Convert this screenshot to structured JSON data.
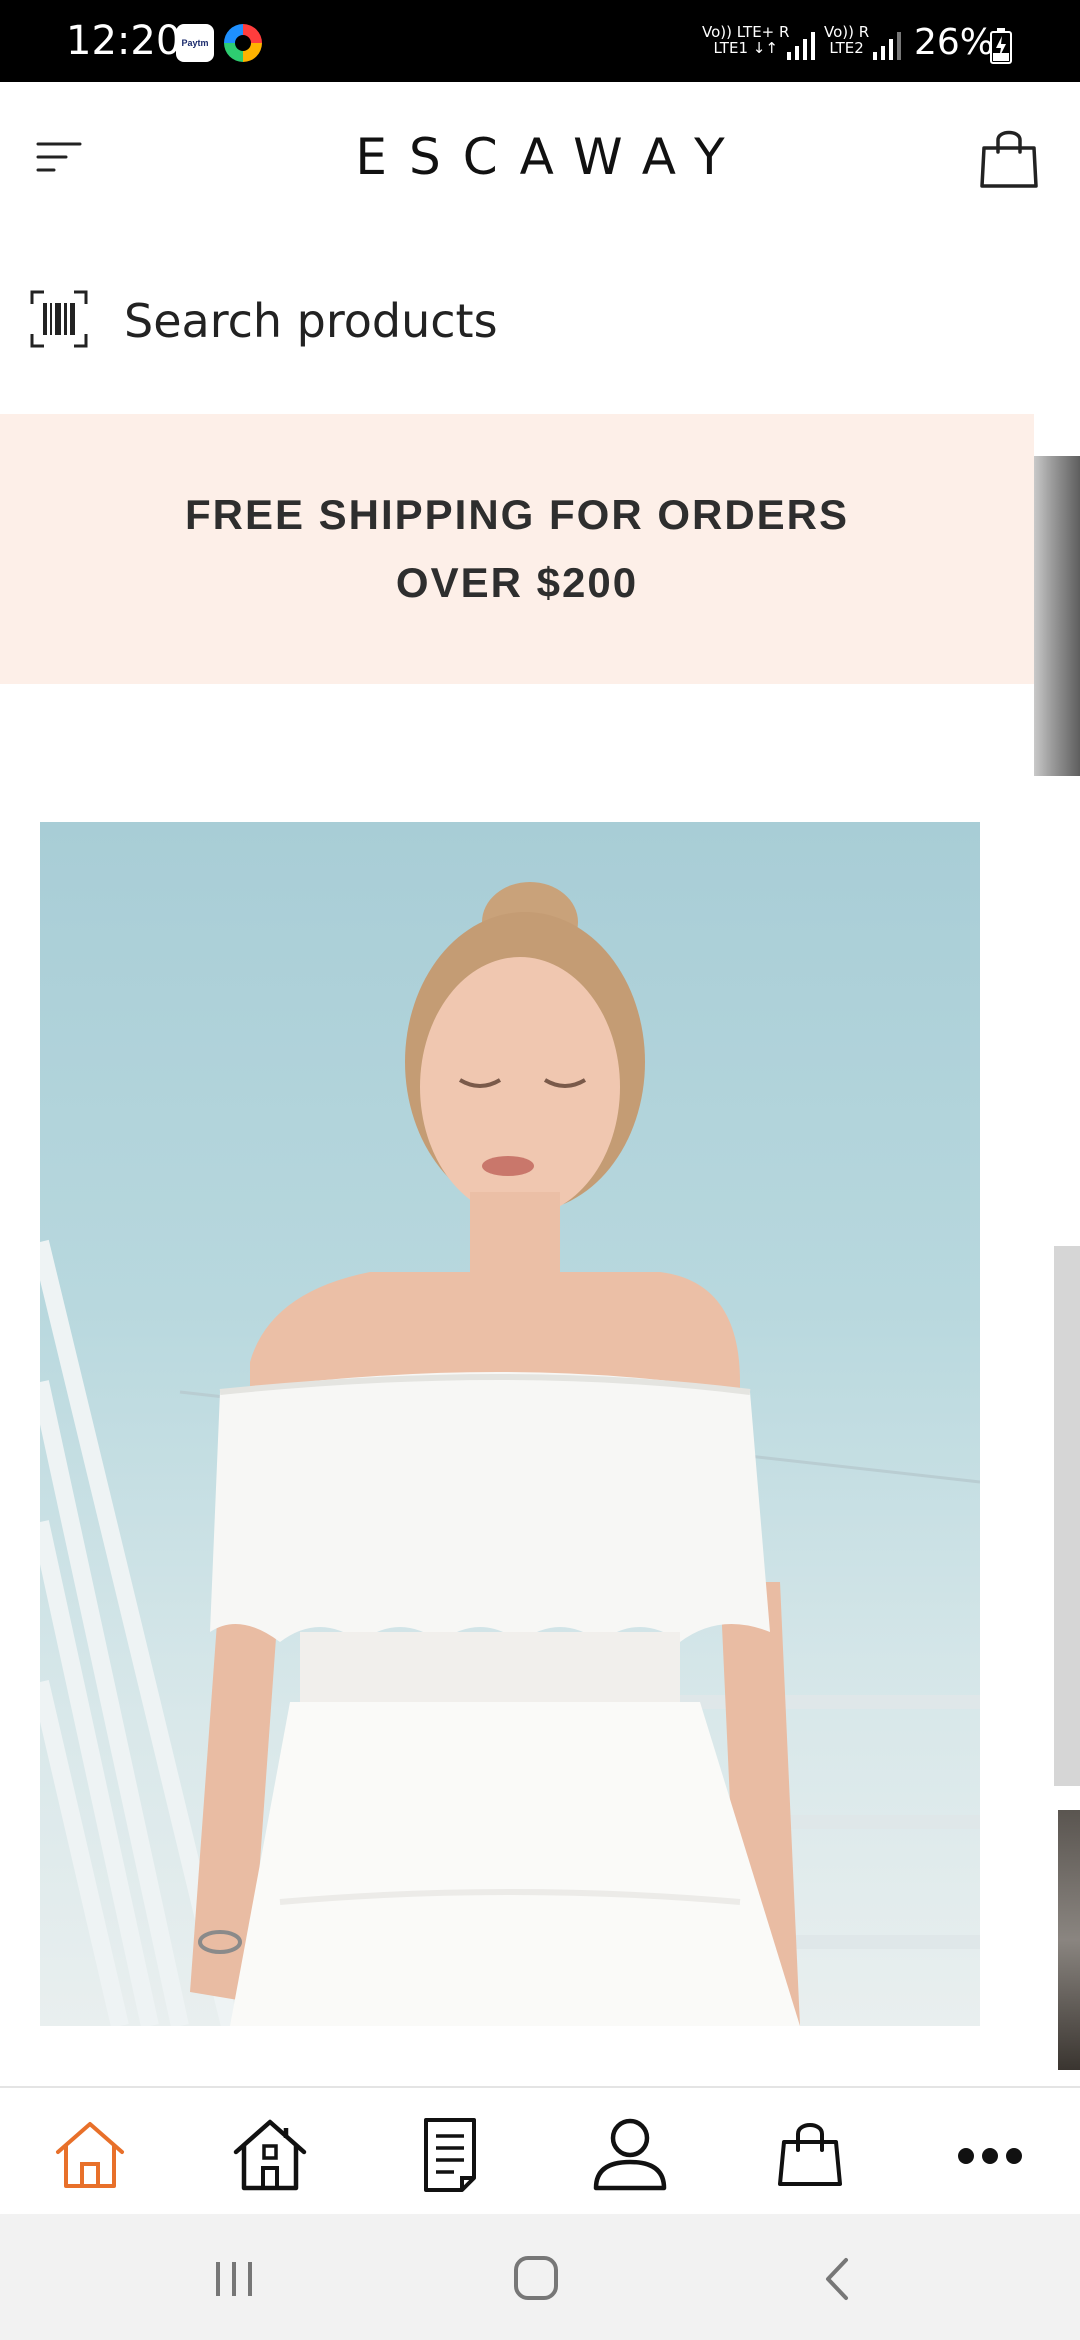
{
  "status_bar": {
    "time": "12:20",
    "paytm_label": "Paytm",
    "sim1_top": "Vo)) LTE+ R",
    "sim1_bottom": "LTE1 ↓↑",
    "sim2_top": "Vo)) R",
    "sim2_bottom": "LTE2",
    "battery": "26%"
  },
  "header": {
    "brand": "ESCAWAY"
  },
  "search": {
    "placeholder": "Search products"
  },
  "promo": {
    "line1": "FREE SHIPPING FOR ORDERS",
    "line2": "OVER $200"
  },
  "bottom_nav": {
    "items": [
      {
        "id": "home",
        "icon": "home-outline-icon",
        "active": true
      },
      {
        "id": "store",
        "icon": "house-icon",
        "active": false
      },
      {
        "id": "orders",
        "icon": "document-icon",
        "active": false
      },
      {
        "id": "account",
        "icon": "user-icon",
        "active": false
      },
      {
        "id": "cart",
        "icon": "shopping-bag-icon",
        "active": false
      },
      {
        "id": "more",
        "icon": "more-icon",
        "active": false
      }
    ],
    "active_color": "#e8702a",
    "inactive_color": "#111111"
  },
  "system_nav": {
    "buttons": [
      "recents-icon",
      "home-icon",
      "back-icon"
    ]
  }
}
